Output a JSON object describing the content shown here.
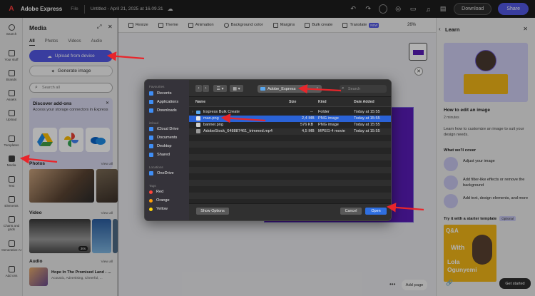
{
  "app": {
    "brand": "Adobe Express",
    "file_label": "File",
    "doc_title": "Untitled - April 21, 2025 at 16.09.31",
    "download_label": "Download",
    "share_label": "Share"
  },
  "rail": [
    {
      "label": "Search",
      "icon": "search-icon"
    },
    {
      "label": "Your stuff",
      "icon": "folder-icon"
    },
    {
      "label": "Brands",
      "icon": "brand-icon"
    },
    {
      "label": "Assets",
      "icon": "assets-icon"
    },
    {
      "label": "Upload",
      "icon": "upload-icon"
    },
    {
      "label": "Templates",
      "icon": "templates-icon"
    },
    {
      "label": "Media",
      "icon": "media-icon"
    },
    {
      "label": "Text",
      "icon": "text-icon"
    },
    {
      "label": "Elements",
      "icon": "elements-icon"
    },
    {
      "label": "Charts and grids",
      "icon": "chart-icon"
    },
    {
      "label": "Generative AI",
      "icon": "sparkle-icon"
    },
    {
      "label": "Add ons",
      "icon": "addon-icon"
    }
  ],
  "media": {
    "title": "Media",
    "tabs": [
      "All",
      "Photos",
      "Videos",
      "Audio"
    ],
    "upload_label": "Upload from device",
    "generate_label": "Generate image",
    "search_placeholder": "Search all",
    "addons_title": "Discover add-ons",
    "addons_desc": "Access your storage connectors in Express",
    "photos_title": "Photos",
    "video_title": "Video",
    "audio_title": "Audio",
    "view_all": "View all",
    "video_duration": "30s",
    "audio_title_track": "Hope In The Promised Land - ...",
    "audio_tags": "Acoustic, Advertising, Cheerful, ..."
  },
  "toolbar": {
    "items": [
      "Resize",
      "Theme",
      "Animation",
      "Background color",
      "Margins",
      "Bulk create",
      "Translate"
    ],
    "new_badge": "NEW",
    "zoom": "26%",
    "add_page": "Add page"
  },
  "learn": {
    "title": "Learn",
    "heading": "How to edit an image",
    "duration": "2 minutes",
    "description": "Learn how to customize an image to suit your design needs.",
    "cover_title": "What we'll cover",
    "steps": [
      "Adjust your image",
      "Add filter-like effects or remove the background",
      "Add text, design elements, and more"
    ],
    "starter": "Try it with a starter template",
    "optional": "Optional",
    "template_text": [
      "Q&A",
      "With",
      "Lola",
      "Ogunyemi"
    ],
    "get_started": "Get started"
  },
  "dialog": {
    "favourites": "Favourites",
    "fav_items": [
      "Recents",
      "Applications",
      "Downloads"
    ],
    "icloud": "iCloud",
    "icloud_items": [
      "iCloud Drive",
      "Documents",
      "Desktop",
      "Shared"
    ],
    "locations": "Locations",
    "location_items": [
      "OneDrive"
    ],
    "tags": "Tags",
    "tag_items": [
      {
        "label": "Red",
        "color": "#ff453a"
      },
      {
        "label": "Orange",
        "color": "#ff9f0a"
      },
      {
        "label": "Yellow",
        "color": "#ffd60a"
      }
    ],
    "folder": "Adobe_Express",
    "search_placeholder": "Search",
    "columns": [
      "Name",
      "Size",
      "Kind",
      "Date Added"
    ],
    "files": [
      {
        "name": "Express Bulk Create",
        "size": "--",
        "kind": "Folder",
        "date": "Today at 15:55"
      },
      {
        "name": "man.png",
        "size": "2,4 MB",
        "kind": "PNG image",
        "date": "Today at 15:55"
      },
      {
        "name": "banner.png",
        "size": "576 KB",
        "kind": "PNG image",
        "date": "Today at 15:55"
      },
      {
        "name": "AdobeStock_648887461_trimmed.mp4",
        "size": "4,5 MB",
        "kind": "MPEG-4 movie",
        "date": "Today at 15:55"
      }
    ],
    "show_options": "Show Options",
    "cancel": "Cancel",
    "open": "Open"
  },
  "colors": {
    "accent": "#5258e4",
    "annotation_arrow": "#e8262b",
    "artboard": "#5a1cb8"
  }
}
